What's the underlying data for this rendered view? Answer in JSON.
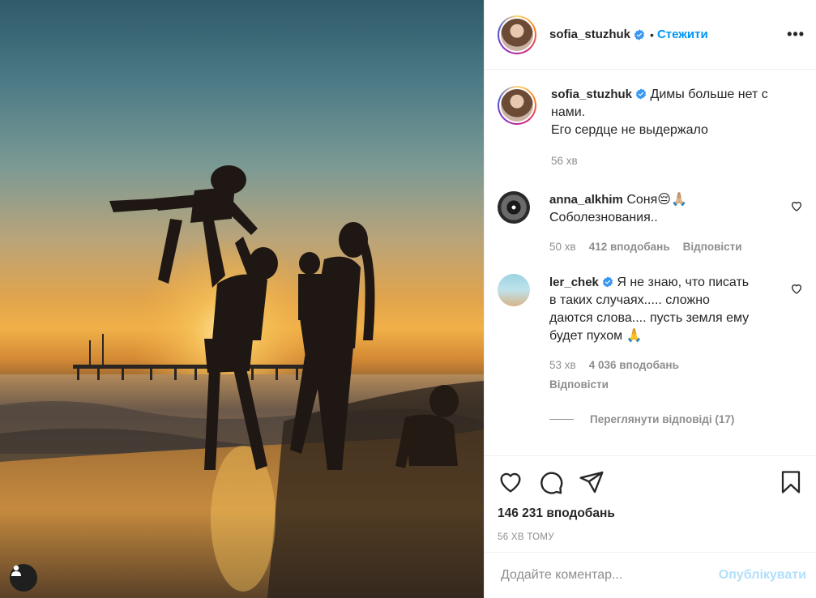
{
  "post": {
    "author": "sofia_stuzhuk",
    "follow_label": "Стежити",
    "more_label": "•••",
    "dot": "•"
  },
  "caption": {
    "username": "sofia_stuzhuk",
    "text_line1": "Димы больше нет с",
    "text_line2": "нами.",
    "text_line3": "Его сердце не выдержало",
    "time": "56 хв"
  },
  "comments": [
    {
      "username": "anna_alkhim",
      "text_line1": "Соня😔🙏🏼",
      "text_line2": "Соболезнования..",
      "time": "50 хв",
      "likes": "412 вподобань",
      "reply": "Відповісти"
    },
    {
      "username": "ler_chek",
      "text_line1": "Я не знаю, что писать",
      "text_line2": "в таких случаях..... сложно",
      "text_line3": "даются слова.... пусть земля ему",
      "text_line4": "будет пухом 🙏",
      "time": "53 хв",
      "likes": "4 036 вподобань",
      "reply": "Відповісти"
    }
  ],
  "view_replies": "Переглянути відповіді (17)",
  "likes_total": "146 231 вподобань",
  "posted_ago": "56 ХВ ТОМУ",
  "comment_input": {
    "placeholder": "Додайте коментар...",
    "value": ""
  },
  "publish_label": "Опублікувати",
  "icons": {
    "verified": "verified-badge-icon",
    "like": "heart-icon",
    "comment": "speech-bubble-icon",
    "share": "paper-plane-icon",
    "save": "bookmark-icon",
    "user_tags": "user-icon"
  },
  "colors": {
    "accent": "#0095f6",
    "publish_disabled": "#b2dffc",
    "muted": "#8e8e8e",
    "text": "#262626"
  }
}
